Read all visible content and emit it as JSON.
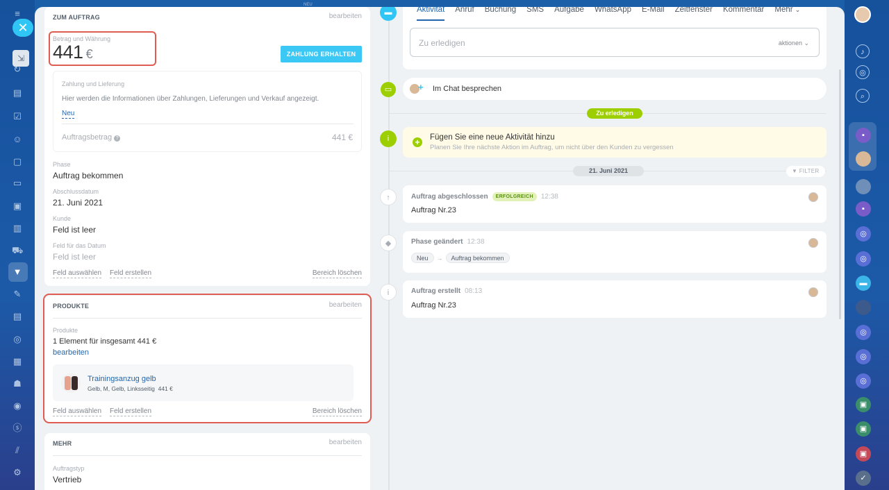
{
  "top_label": "NEU",
  "order_card": {
    "header": "ZUM AUFTRAG",
    "edit": "bearbeiten",
    "amount_label": "Betrag und Währung",
    "amount_value": "441",
    "amount_currency": "€",
    "pay_button": "ZAHLUNG ERHALTEN",
    "payment": {
      "title": "Zahlung und Lieferung",
      "description": "Hier werden die Informationen über Zahlungen, Lieferungen und Verkauf angezeigt.",
      "new_link": "Neu",
      "total_label": "Auftragsbetrag",
      "total_value": "441 €"
    },
    "fields": [
      {
        "label": "Phase",
        "value": "Auftrag bekommen"
      },
      {
        "label": "Abschlussdatum",
        "value": "21. Juni 2021"
      },
      {
        "label": "Kunde",
        "value": "Feld ist leer"
      },
      {
        "label": "Feld für das Datum",
        "value": "Feld ist leer"
      }
    ],
    "select_field": "Feld auswählen",
    "create_field": "Feld erstellen",
    "delete_section": "Bereich löschen"
  },
  "products_card": {
    "header": "PRODUKTE",
    "edit": "bearbeiten",
    "label": "Produkte",
    "summary": "1 Element für insgesamt 441 €",
    "edit_link": "bearbeiten",
    "product": {
      "name": "Trainingsanzug gelb",
      "details": "Gelb, M, Gelb, Linksseitig",
      "price": "441 €"
    },
    "select_field": "Feld auswählen",
    "create_field": "Feld erstellen",
    "delete_section": "Bereich löschen"
  },
  "more_card": {
    "header": "MEHR",
    "edit": "bearbeiten",
    "field_label": "Auftragstyp",
    "field_value": "Vertrieb"
  },
  "activity": {
    "tabs": [
      "Aktivität",
      "Anruf",
      "Buchung",
      "SMS",
      "Aufgabe",
      "WhatsApp",
      "E-Mail",
      "Zeitfenster",
      "Kommentar",
      "Mehr"
    ],
    "todo_placeholder": "Zu erledigen",
    "todo_actions": "aktionen",
    "chat": "Im Chat besprechen",
    "todo_pill": "Zu erledigen",
    "add_title": "Fügen Sie eine neue Aktivität hinzu",
    "add_subtitle": "Planen Sie Ihre nächste Aktion im Auftrag, um nicht über den Kunden zu vergessen",
    "date_pill": "21. Juni 2021",
    "filter": "FILTER"
  },
  "timeline": [
    {
      "title": "Auftrag abgeschlossen",
      "badge": "ERFOLGREICH",
      "time": "12:38",
      "body": "Auftrag Nr.23"
    },
    {
      "title": "Phase geändert",
      "time": "12:38",
      "from": "Neu",
      "to": "Auftrag bekommen"
    },
    {
      "title": "Auftrag erstellt",
      "time": "08:13",
      "body": "Auftrag Nr.23"
    }
  ],
  "colors": {
    "accent": "#2067b0",
    "green": "#9dcf00",
    "highlight": "#e05c52",
    "button": "#3bc8f5"
  }
}
